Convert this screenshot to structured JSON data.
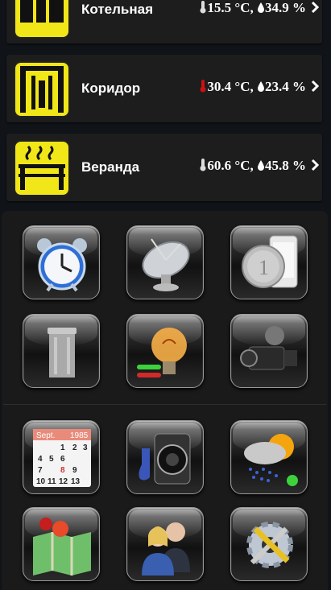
{
  "rooms": [
    {
      "name": "Котельная",
      "temperature": "15.5 °C,",
      "humidity": "34.9 %"
    },
    {
      "name": "Коридор",
      "temperature": "30.4 °C,",
      "humidity": "23.4 %"
    },
    {
      "name": "Веранда",
      "temperature": "60.6 °C,",
      "humidity": "45.8 %"
    }
  ],
  "calendar": {
    "month": "Sept.",
    "year": "1985",
    "numbers": [
      "1",
      "2",
      "3",
      "4",
      "5",
      "6",
      "7",
      "8",
      "9",
      "10",
      "11",
      "12",
      "13"
    ]
  },
  "tiles": [
    {
      "icon": "alarm-clock-icon"
    },
    {
      "icon": "satellite-dish-icon"
    },
    {
      "icon": "coin-phone-icon"
    },
    {
      "icon": "trash-can-icon"
    },
    {
      "icon": "light-bulb-icon"
    },
    {
      "icon": "video-camera-icon"
    },
    {
      "icon": "calendar-icon"
    },
    {
      "icon": "speaker-icon"
    },
    {
      "icon": "weather-icon"
    },
    {
      "icon": "map-icon"
    },
    {
      "icon": "people-icon"
    },
    {
      "icon": "settings-icon"
    }
  ],
  "colors": {
    "accent_yellow": "#f1e617",
    "thermo_red": "#cc1111",
    "active_green": "#3cd23c"
  }
}
